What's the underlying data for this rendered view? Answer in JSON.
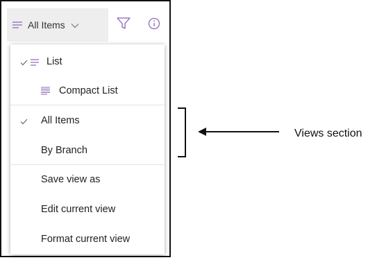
{
  "toolbar": {
    "view_label": "All Items",
    "icons": [
      "list-lines-icon",
      "chevron-down-icon",
      "filter-icon",
      "info-icon"
    ]
  },
  "menu": {
    "layout_items": [
      {
        "label": "List",
        "checked": true,
        "icon": "list-lines-icon"
      },
      {
        "label": "Compact List",
        "checked": false,
        "icon": "compact-list-icon"
      }
    ],
    "view_items": [
      {
        "label": "All Items",
        "checked": true
      },
      {
        "label": "By Branch",
        "checked": false
      }
    ],
    "action_items": [
      {
        "label": "Save view as"
      },
      {
        "label": "Edit current view"
      },
      {
        "label": "Format current view"
      }
    ]
  },
  "annotation": {
    "label": "Views section"
  },
  "colors": {
    "accent": "#8764b8",
    "toolbar_bg": "#eeeeee",
    "check": "#666666"
  }
}
